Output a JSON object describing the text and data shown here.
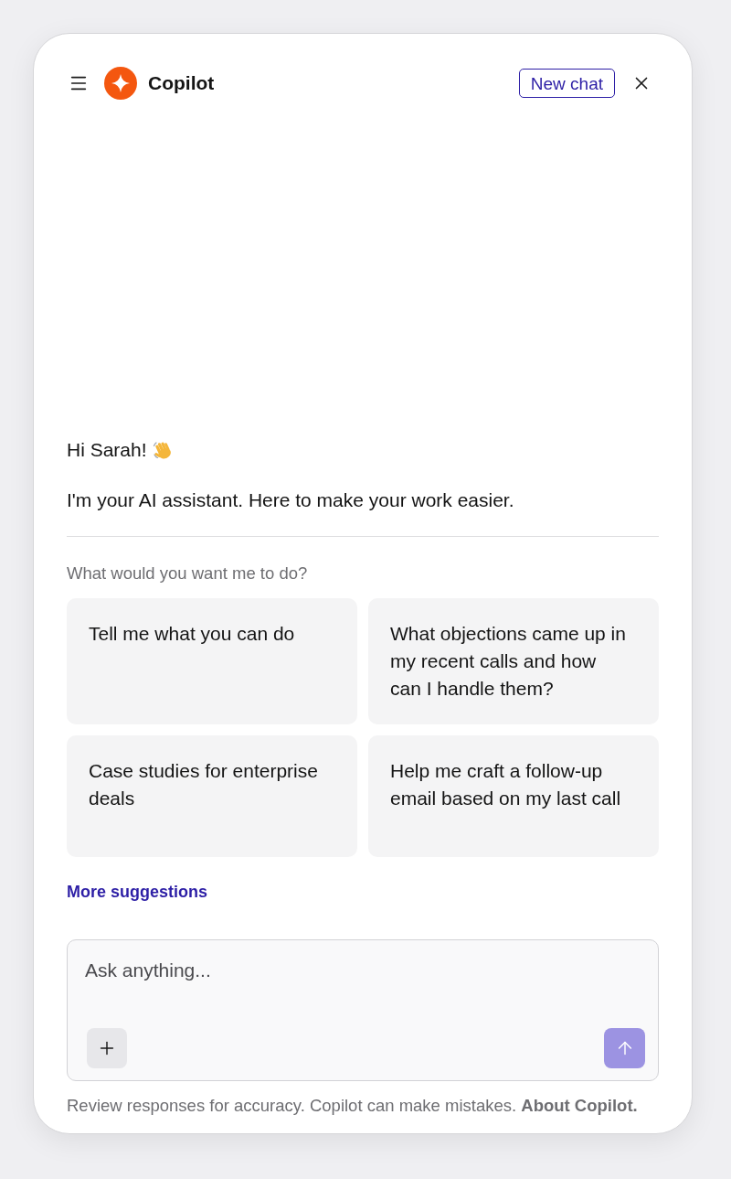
{
  "header": {
    "title": "Copilot",
    "new_chat_button": "New chat"
  },
  "greeting": "Hi Sarah!",
  "intro": "I'm your AI assistant. Here to make your work easier.",
  "suggestions": {
    "label": "What would you want me to do?",
    "items": [
      "Tell me what you can do",
      "What objections came up in my recent calls and how can I handle them?",
      "Case studies for enterprise deals",
      "Help me craft a follow-up email based on my last call"
    ],
    "more_link": "More suggestions"
  },
  "composer": {
    "placeholder": "Ask anything...",
    "send_disabled": true
  },
  "footer": {
    "text": "Review responses for accuracy. Copilot can make mistakes.",
    "link": "About Copilot."
  }
}
